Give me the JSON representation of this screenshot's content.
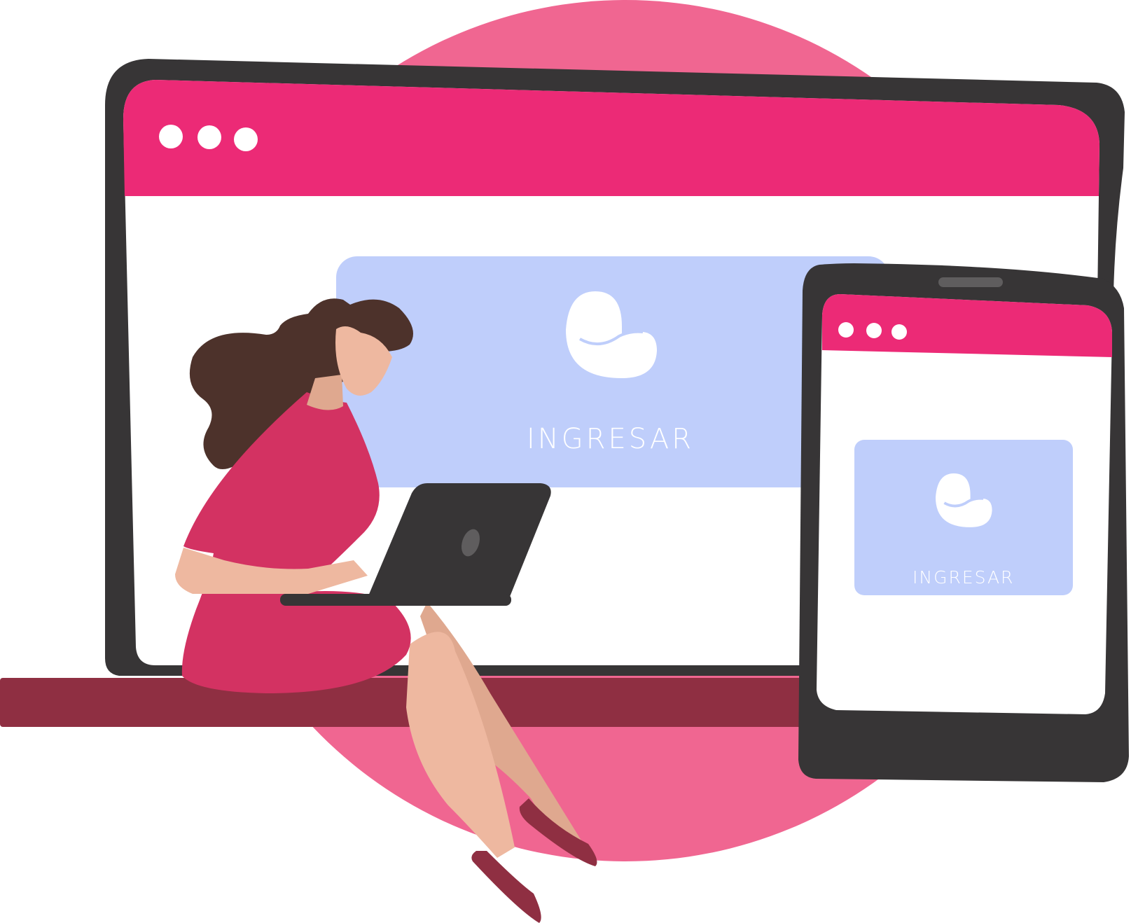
{
  "colors": {
    "background_circle": "#f06691",
    "frame": "#373536",
    "screen": "#ffffff",
    "titlebar": "#ec2a76",
    "window_dot": "#ffffff",
    "login_card": "#bfcefb",
    "logo": "#ffffff",
    "shelf": "#8f2f42",
    "skin": "#eeb8a0",
    "skin_shadow": "#dfa88f",
    "hair": "#4d322b",
    "dress": "#d33262",
    "shoes": "#8f2f42",
    "laptop": "#373536"
  },
  "desktop_window": {
    "window_controls": [
      "dot",
      "dot",
      "dot"
    ],
    "login_button": {
      "label": "INGRESAR",
      "icon": "logo-icon"
    }
  },
  "tablet_window": {
    "window_controls": [
      "dot",
      "dot",
      "dot"
    ],
    "login_button": {
      "label": "INGRESAR",
      "icon": "logo-icon"
    }
  },
  "illustration": {
    "figure": "woman-with-laptop",
    "laptop_icon": "laptop-logo-icon"
  }
}
